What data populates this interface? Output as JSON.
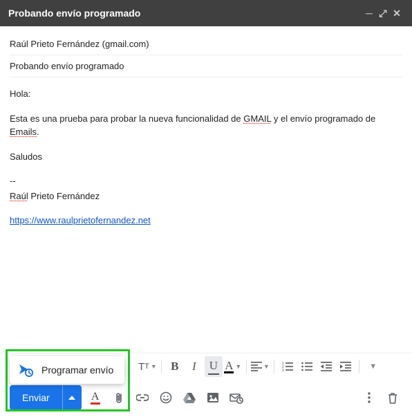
{
  "window": {
    "title": "Probando envío programado"
  },
  "header": {
    "to": "Raúl Prieto Fernández (gmail.com)",
    "subject": "Probando envío programado"
  },
  "body": {
    "greeting": "Hola:",
    "line1_part1": "Esta es una prueba para probar la nueva funcionalidad de ",
    "line1_spell1": "GMAIL",
    "line1_part2": " y el envío programado de ",
    "line1_spell2": "Emails",
    "line1_part3": ".",
    "closing": "Saludos",
    "sig_sep": "--",
    "sig_name_spell": "Raúl",
    "sig_name_rest": " Prieto Fernández",
    "sig_link": "https://www.raulprietofernandez.net"
  },
  "schedule_popup": {
    "label": "Programar envío"
  },
  "send": {
    "label": "Enviar"
  },
  "format_toolbar": {
    "font_size": "tT",
    "bold": "B",
    "italic": "I",
    "underline": "U",
    "textcolor": "A"
  }
}
